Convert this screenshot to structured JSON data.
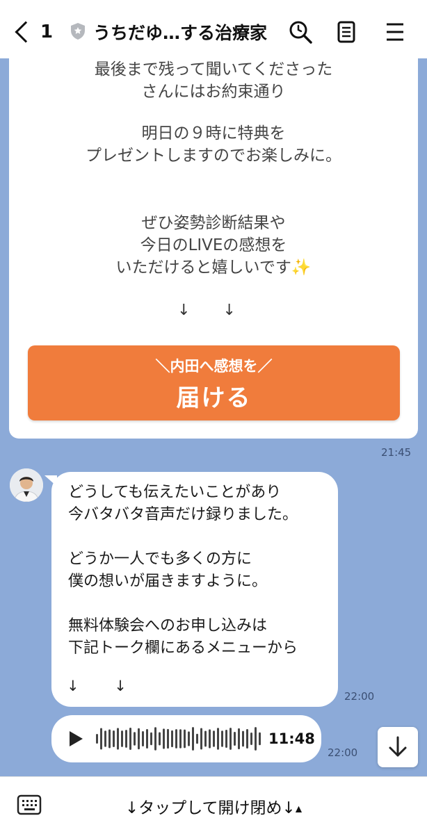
{
  "header": {
    "back_count": "1",
    "title": "うちだゆ…する治療家"
  },
  "card": {
    "line1": "最後まで残って聞いてくださった",
    "line2": "さんにはお約束通り",
    "line3": "明日の９時に特典を",
    "line4": "プレゼントしますのでお楽しみに。",
    "line5": "ぜひ姿勢診断結果や",
    "line6": "今日のLIVEの感想を",
    "line7": "いただけると嬉しいです✨",
    "arrows": "↓ ↓",
    "button_sub": "＼内田へ感想を／",
    "button_main": "届ける",
    "time": "21:45"
  },
  "message": {
    "text": "どうしても伝えたいことがあり\n今バタバタ音声だけ録りました。\n\nどうか一人でも多くの方に\n僕の想いが届きますように。\n\n無料体験会へのお申し込みは\n下記トーク欄にあるメニューから",
    "arrows": "↓ ↓",
    "time": "22:00"
  },
  "audio": {
    "duration": "11:48",
    "time": "22:00"
  },
  "bottom": {
    "menu_toggle": "↓タップして開け閉め↓",
    "menu_toggle_indicator": "▲"
  },
  "colors": {
    "chat_background": "#8caad8",
    "cta_button": "#f07c3c",
    "header": "#ffffff"
  },
  "icons": {
    "back": "chevron-left-icon",
    "verified": "shield-icon",
    "search": "search-icon",
    "notes": "notes-icon",
    "menu": "hamburger-menu-icon",
    "play": "play-icon",
    "scroll": "arrow-down-icon",
    "keyboard": "keyboard-icon"
  }
}
